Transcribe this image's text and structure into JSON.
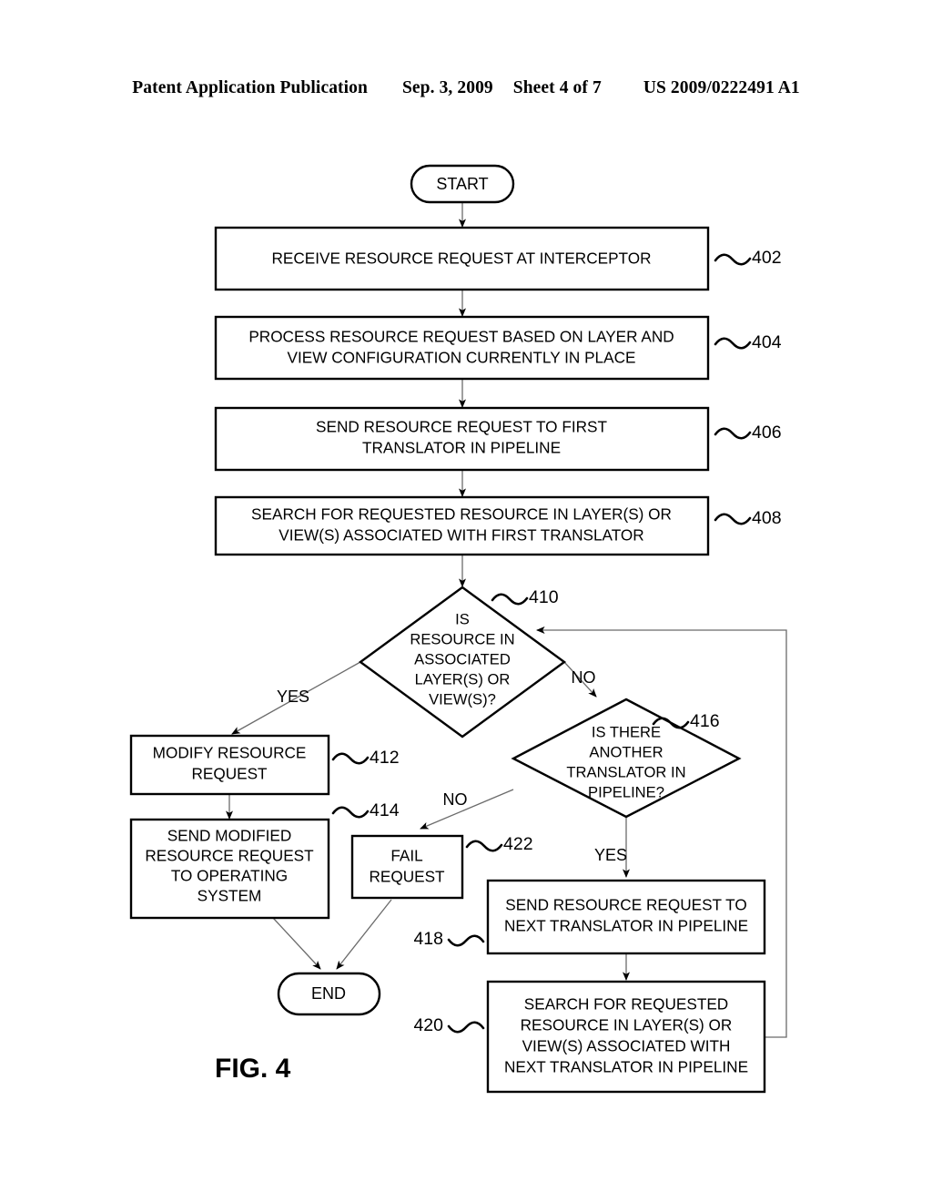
{
  "header": {
    "publication": "Patent Application Publication",
    "date": "Sep. 3, 2009",
    "sheet": "Sheet 4 of 7",
    "patent_number": "US 2009/0222491 A1"
  },
  "figure": {
    "caption": "FIG. 4",
    "type": "flowchart",
    "terminals": {
      "start": "START",
      "end": "END"
    },
    "nodes": [
      {
        "ref": "402",
        "shape": "process",
        "lines": [
          "RECEIVE RESOURCE REQUEST AT INTERCEPTOR"
        ]
      },
      {
        "ref": "404",
        "shape": "process",
        "lines": [
          "PROCESS RESOURCE REQUEST BASED ON LAYER AND",
          "VIEW CONFIGURATION CURRENTLY IN PLACE"
        ]
      },
      {
        "ref": "406",
        "shape": "process",
        "lines": [
          "SEND RESOURCE REQUEST TO FIRST",
          "TRANSLATOR IN PIPELINE"
        ]
      },
      {
        "ref": "408",
        "shape": "process",
        "lines": [
          "SEARCH FOR REQUESTED RESOURCE IN LAYER(S) OR",
          "VIEW(S) ASSOCIATED WITH FIRST TRANSLATOR"
        ]
      },
      {
        "ref": "410",
        "shape": "decision",
        "lines": [
          "IS",
          "RESOURCE IN",
          "ASSOCIATED",
          "LAYER(S) OR",
          "VIEW(S)?"
        ]
      },
      {
        "ref": "412",
        "shape": "process",
        "lines": [
          "MODIFY RESOURCE",
          "REQUEST"
        ]
      },
      {
        "ref": "414",
        "shape": "process",
        "lines": [
          "SEND MODIFIED",
          "RESOURCE REQUEST",
          "TO OPERATING",
          "SYSTEM"
        ]
      },
      {
        "ref": "416",
        "shape": "decision",
        "lines": [
          "IS THERE",
          "ANOTHER",
          "TRANSLATOR IN",
          "PIPELINE?"
        ]
      },
      {
        "ref": "418",
        "shape": "process",
        "lines": [
          "SEND RESOURCE REQUEST TO",
          "NEXT TRANSLATOR IN PIPELINE"
        ]
      },
      {
        "ref": "420",
        "shape": "process",
        "lines": [
          "SEARCH FOR REQUESTED",
          "RESOURCE IN LAYER(S) OR",
          "VIEW(S) ASSOCIATED WITH",
          "NEXT TRANSLATOR IN PIPELINE"
        ]
      },
      {
        "ref": "422",
        "shape": "process",
        "lines": [
          "FAIL",
          "REQUEST"
        ]
      }
    ],
    "edge_labels": {
      "yes_410": "YES",
      "no_410": "NO",
      "yes_416": "YES",
      "no_416": "NO"
    },
    "colors": {
      "ink": "#000000",
      "paper": "#ffffff",
      "flowline": "#6b6b6b"
    }
  }
}
